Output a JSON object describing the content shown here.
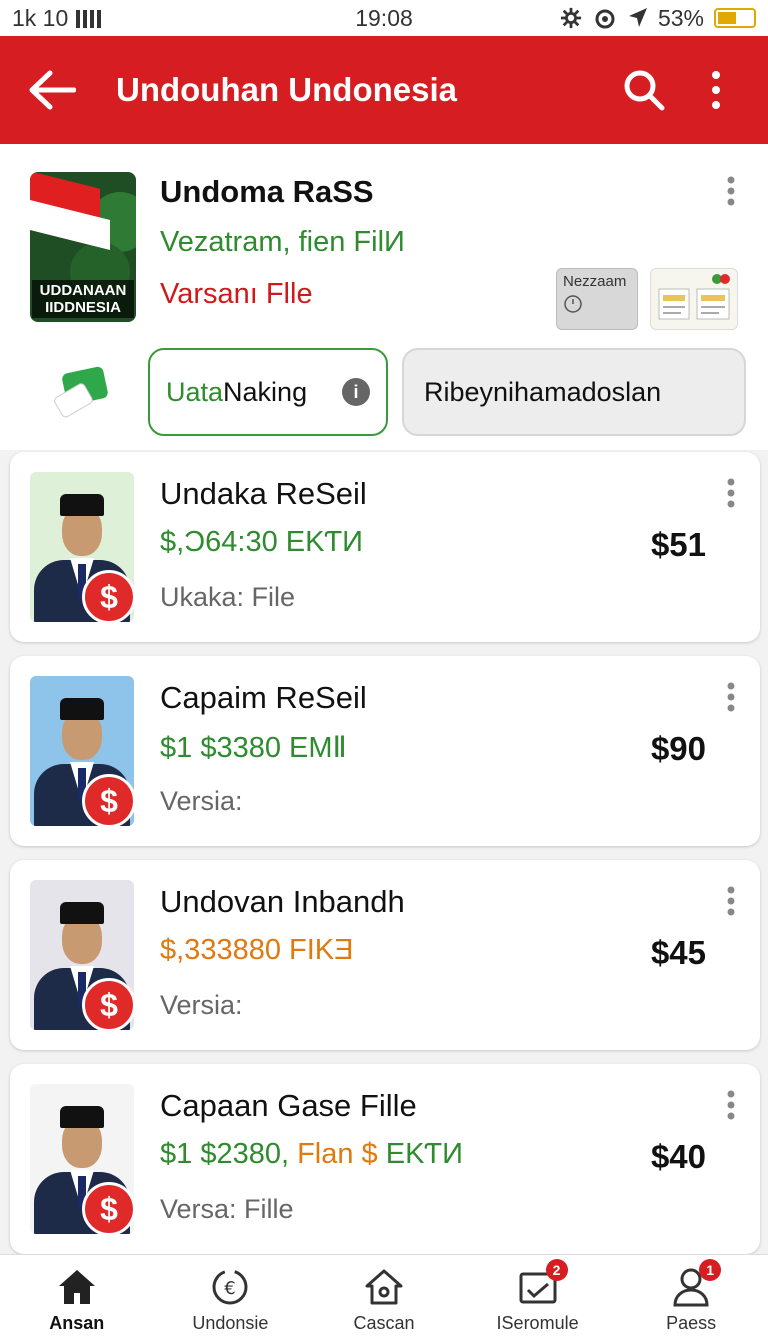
{
  "status": {
    "left": "1k 10",
    "time": "19:08",
    "battery": "53%"
  },
  "appbar": {
    "title": "Undouhan Undonesia"
  },
  "hero": {
    "thumb_caption_line1": "UDDANAAN",
    "thumb_caption_line2": "IIDDNESIA",
    "title": "Undoma RaSS",
    "subtitle": "Vezatram, fien FilИ",
    "subtitle2": "Varsanı Flle",
    "mini_card_a": "Nezzaam"
  },
  "chips": {
    "one_green": "Uata",
    "one_rest": " Naking",
    "two": "Ribeynihamadoslan"
  },
  "items": [
    {
      "name": "Undaka ReSeil",
      "meta": "$,Ɔ64:30 EKƬИ",
      "version": "Ukaka: File",
      "price": "$51",
      "bg": "#dff0d8"
    },
    {
      "name": "Capaim ReSeil",
      "meta": "$1 $3380 EMⅡ",
      "version": "Versia:",
      "price": "$90",
      "bg": "#8ec3ea"
    },
    {
      "name": "Undovan Inbandh",
      "meta": "$,333880 FIKƎ",
      "version": "Versia:",
      "price": "$45",
      "bg": "#e4e4ea"
    },
    {
      "name": "Capaan Gase Fille",
      "meta_green": "$1 $2380,",
      "meta_orange": " Flan $",
      "meta_green2": " EKƬИ",
      "version": "Versa: Fille",
      "price": "$40",
      "bg": "#f4f4f4"
    }
  ],
  "nav": [
    {
      "label": "Ansan",
      "icon": "home-icon"
    },
    {
      "label": "Undonsie",
      "icon": "sync-icon"
    },
    {
      "label": "Cascan",
      "icon": "house-outline-icon"
    },
    {
      "label": "ISeromule",
      "icon": "inbox-icon",
      "badge": "2"
    },
    {
      "label": "Paess",
      "icon": "person-icon",
      "badge": "1"
    }
  ],
  "colors": {
    "appbar": "#d51d22",
    "green": "#2e8b2e",
    "red": "#d01a1a",
    "orange": "#e07a10"
  }
}
